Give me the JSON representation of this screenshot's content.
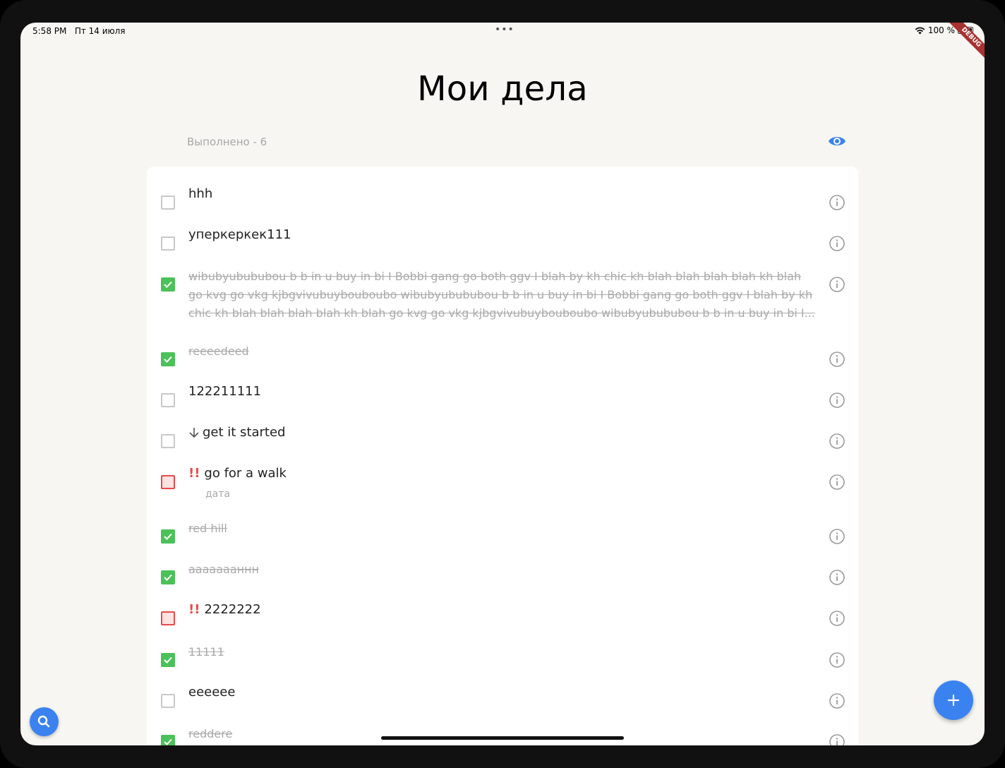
{
  "status_bar": {
    "time": "5:58 PM",
    "date": "Пт 14 июля",
    "battery": "100 %",
    "debug_label": "DEBUG"
  },
  "header": {
    "title": "Мои дела",
    "done_count": "Выполнено - 6",
    "visibility_icon": "eye-icon"
  },
  "colors": {
    "accent": "#3a82f0",
    "done_green": "#4cc15a",
    "urgent_red": "#e84a4a"
  },
  "tasks": [
    {
      "text": "hhh",
      "done": false
    },
    {
      "text": "уперкеркек111",
      "done": false
    },
    {
      "text": "wibubyubububou b b in u buy in bi I Bobbi gang go both ggv I blah by kh chic kh blah blah blah blah kh blah go kvg go vkg kjbgvivubuybouboubo wibubyubububou b b in u buy in bi I Bobbi gang go both ggv I blah by kh chic kh blah blah blah blah kh blah go kvg go vkg kjbgvivubuybouboubo wibubyubububou b b in u buy in bi I...",
      "done": true
    },
    {
      "text": "reeeedeed",
      "done": true
    },
    {
      "text": "122211111",
      "done": false
    },
    {
      "text": "get it started",
      "done": false,
      "priority": "low"
    },
    {
      "text": "go for a walk",
      "done": false,
      "priority": "high",
      "priority_mark": "!!",
      "subtitle": "дата"
    },
    {
      "text": "red hill",
      "done": true
    },
    {
      "text": "aaaaaaaннн",
      "done": true
    },
    {
      "text": "2222222",
      "done": false,
      "priority": "high",
      "priority_mark": "!!"
    },
    {
      "text": "11111",
      "done": true
    },
    {
      "text": "eeeeee",
      "done": false
    },
    {
      "text": "reddere",
      "done": true
    }
  ],
  "buttons": {
    "add_icon": "plus-icon",
    "search_icon": "search-icon"
  }
}
